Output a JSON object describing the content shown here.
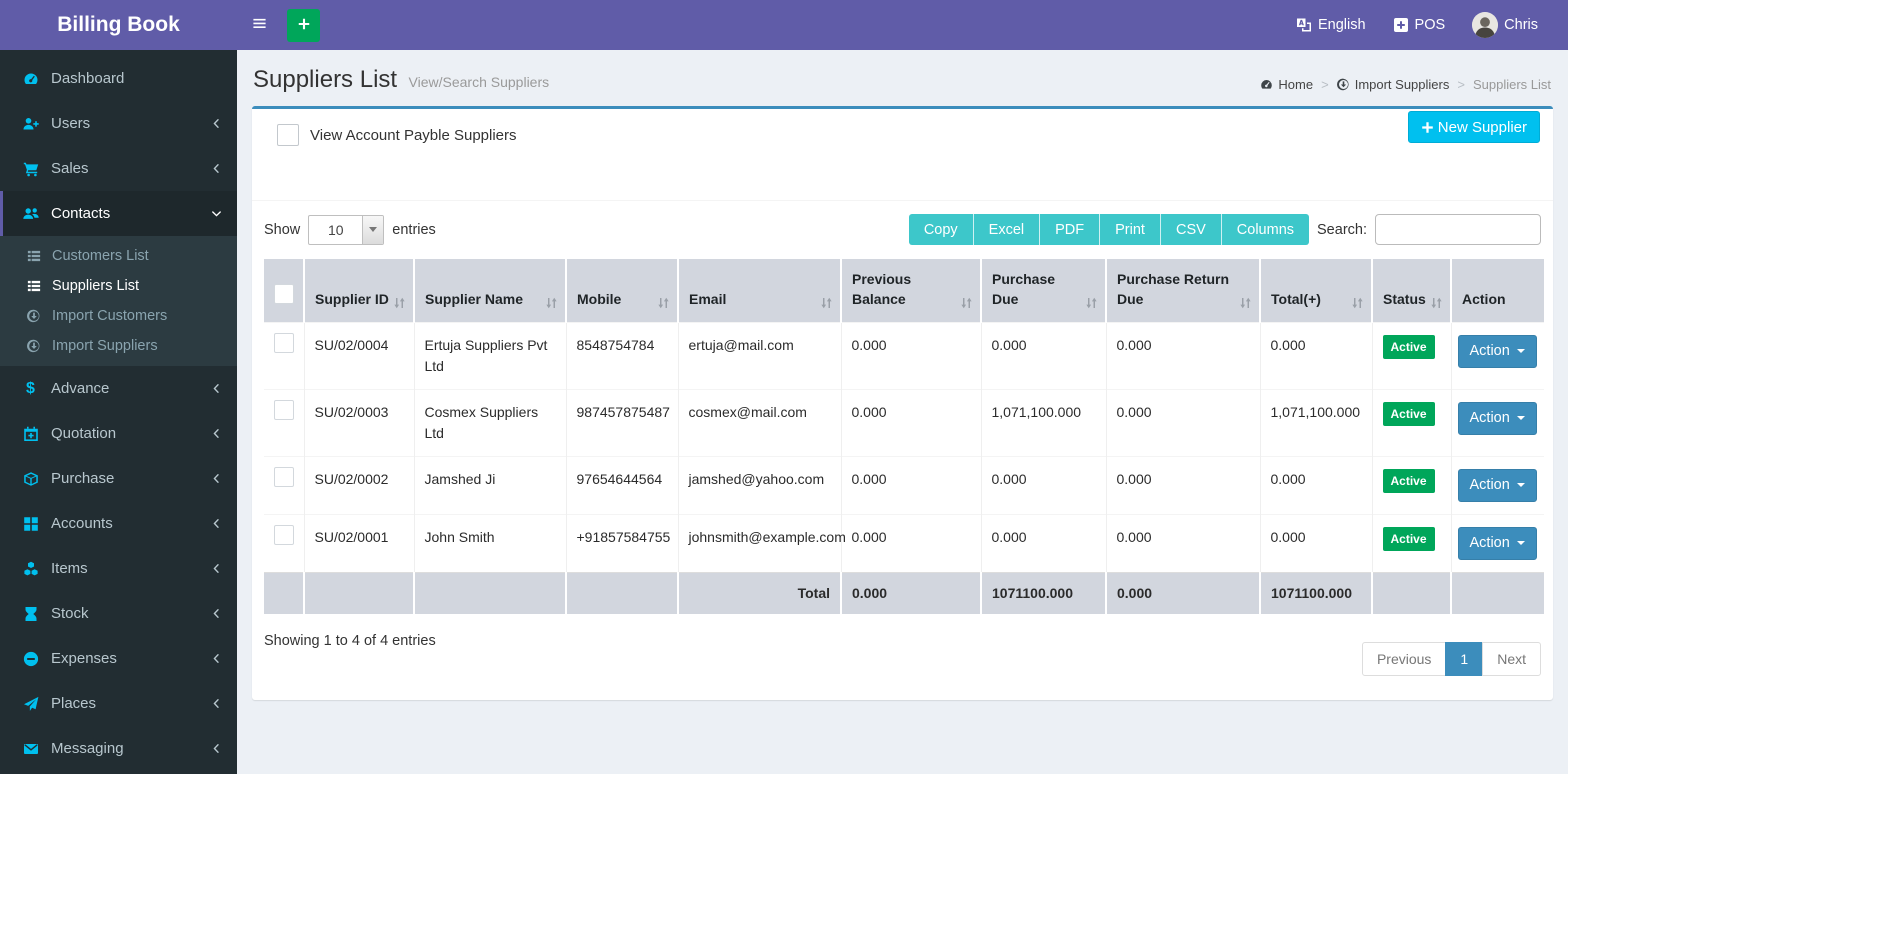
{
  "navbar": {
    "brand": "Billing Book",
    "language": "English",
    "pos": "POS",
    "user": "Chris"
  },
  "sidebar": {
    "items": [
      {
        "label": "Dashboard",
        "icon": "tachometer"
      },
      {
        "label": "Users",
        "icon": "user-plus",
        "chevron": "left"
      },
      {
        "label": "Sales",
        "icon": "cart",
        "chevron": "left"
      },
      {
        "label": "Contacts",
        "icon": "users",
        "chevron": "down",
        "active": true,
        "submenu": [
          {
            "label": "Customers List",
            "icon": "th-list"
          },
          {
            "label": "Suppliers List",
            "icon": "th-list",
            "active": true
          },
          {
            "label": "Import Customers",
            "icon": "arrow-circle"
          },
          {
            "label": "Import Suppliers",
            "icon": "arrow-circle"
          }
        ]
      },
      {
        "label": "Advance",
        "icon": "dollar",
        "chevron": "left"
      },
      {
        "label": "Quotation",
        "icon": "calendar-plus",
        "chevron": "left"
      },
      {
        "label": "Purchase",
        "icon": "cube",
        "chevron": "left"
      },
      {
        "label": "Accounts",
        "icon": "th",
        "chevron": "left"
      },
      {
        "label": "Items",
        "icon": "cubes",
        "chevron": "left"
      },
      {
        "label": "Stock",
        "icon": "hourglass",
        "chevron": "left"
      },
      {
        "label": "Expenses",
        "icon": "minus-circle",
        "chevron": "left"
      },
      {
        "label": "Places",
        "icon": "paper-plane",
        "chevron": "left"
      },
      {
        "label": "Messaging",
        "icon": "envelope",
        "chevron": "left"
      }
    ]
  },
  "page": {
    "title": "Suppliers List",
    "subtitle": "View/Search Suppliers",
    "breadcrumb": [
      {
        "label": "Home",
        "icon": "tachometer"
      },
      {
        "label": "Import Suppliers",
        "icon": "arrow-circle"
      },
      {
        "label": "Suppliers List"
      }
    ]
  },
  "card": {
    "filter_label": "View Account Payble Suppliers",
    "new_supplier": "New Supplier",
    "show_label": "Show",
    "page_length": "10",
    "entries_label": "entries",
    "export_buttons": [
      "Copy",
      "Excel",
      "PDF",
      "Print",
      "CSV",
      "Columns"
    ],
    "search_label": "Search:",
    "search_value": "",
    "table": {
      "columns": [
        {
          "label": "Supplier ID",
          "sortable": true
        },
        {
          "label": "Supplier Name",
          "sortable": true
        },
        {
          "label": "Mobile",
          "sortable": true
        },
        {
          "label": "Email",
          "sortable": true
        },
        {
          "label": "Previous Balance",
          "sortable": true
        },
        {
          "label": "Purchase Due",
          "sortable": true
        },
        {
          "label": "Purchase Return Due",
          "sortable": true
        },
        {
          "label": "Total(+)",
          "sortable": true
        },
        {
          "label": "Status",
          "sortable": true
        },
        {
          "label": "Action",
          "sortable": false
        }
      ],
      "rows": [
        {
          "cells": [
            "SU/02/0004",
            "Ertuja Suppliers Pvt Ltd",
            "8548754784",
            "ertuja@mail.com",
            "0.000",
            "0.000",
            "0.000",
            "0.000"
          ],
          "status": "Active",
          "action": "Action"
        },
        {
          "cells": [
            "SU/02/0003",
            "Cosmex Suppliers Ltd",
            "987457875487",
            "cosmex@mail.com",
            "0.000",
            "1,071,100.000",
            "0.000",
            "1,071,100.000"
          ],
          "status": "Active",
          "action": "Action"
        },
        {
          "cells": [
            "SU/02/0002",
            "Jamshed Ji",
            "97654644564",
            "jamshed@yahoo.com",
            "0.000",
            "0.000",
            "0.000",
            "0.000"
          ],
          "status": "Active",
          "action": "Action"
        },
        {
          "cells": [
            "SU/02/0001",
            "John Smith",
            "+91857584755",
            "johnsmith@example.com",
            "0.000",
            "0.000",
            "0.000",
            "0.000"
          ],
          "status": "Active",
          "action": "Action"
        }
      ],
      "footer": {
        "label": "Total",
        "values": [
          "0.000",
          "1071100.000",
          "0.000",
          "1071100.000"
        ]
      }
    },
    "summary": "Showing 1 to 4 of 4 entries",
    "pagination": {
      "previous": "Previous",
      "current": "1",
      "next": "Next"
    }
  },
  "colors": {
    "purple": "#605ca8",
    "sidebar_bg": "#222d32",
    "sidebar_active_bg": "#1e282c",
    "submenu_bg": "#2c3b41",
    "sidebar_text": "#b8c7ce",
    "icon_cyan": "#00c0ef",
    "content_bg": "#ecf0f5",
    "card_accent": "#3c8dbc",
    "green": "#00a65a",
    "teal": "#3dc7ca",
    "table_head_bg": "#d2d6de",
    "action_blue": "#3c8dbc"
  }
}
